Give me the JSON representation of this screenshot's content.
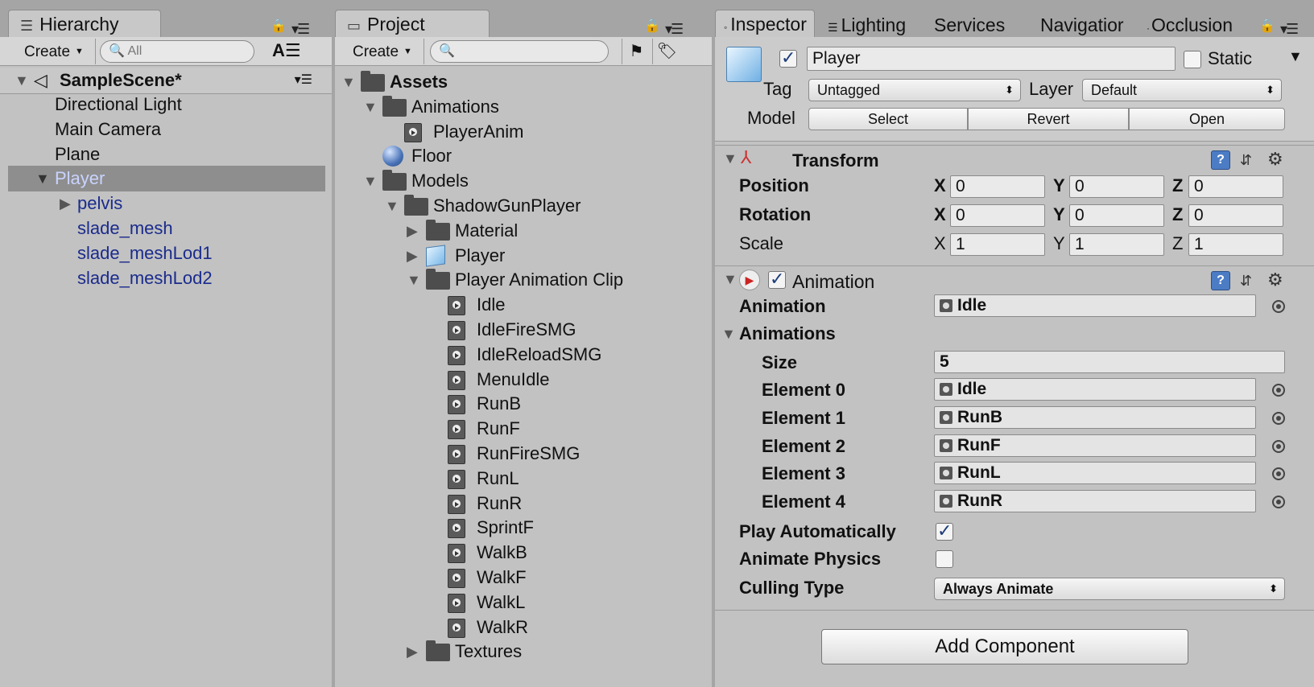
{
  "hierarchy": {
    "tab_label": "Hierarchy",
    "create_label": "Create",
    "search_placeholder": "All",
    "scene_name": "SampleScene*",
    "items": [
      {
        "label": "Directional Light"
      },
      {
        "label": "Main Camera"
      },
      {
        "label": "Plane"
      },
      {
        "label": "Player"
      },
      {
        "label": "pelvis"
      },
      {
        "label": "slade_mesh"
      },
      {
        "label": "slade_meshLod1"
      },
      {
        "label": "slade_meshLod2"
      }
    ]
  },
  "project": {
    "tab_label": "Project",
    "create_label": "Create",
    "search_placeholder": "",
    "items": [
      {
        "label": "Assets",
        "icon": "folder-icon"
      },
      {
        "label": "Animations",
        "icon": "folder-icon"
      },
      {
        "label": "PlayerAnim",
        "icon": "animation-clip-icon"
      },
      {
        "label": "Floor",
        "icon": "material-sphere-icon"
      },
      {
        "label": "Models",
        "icon": "folder-icon"
      },
      {
        "label": "ShadowGunPlayer",
        "icon": "folder-icon"
      },
      {
        "label": "Material",
        "icon": "folder-icon"
      },
      {
        "label": "Player",
        "icon": "prefab-cube-icon"
      },
      {
        "label": "Player Animation Clip",
        "icon": "folder-icon"
      },
      {
        "label": "Idle",
        "icon": "animation-clip-icon"
      },
      {
        "label": "IdleFireSMG",
        "icon": "animation-clip-icon"
      },
      {
        "label": "IdleReloadSMG",
        "icon": "animation-clip-icon"
      },
      {
        "label": "MenuIdle",
        "icon": "animation-clip-icon"
      },
      {
        "label": "RunB",
        "icon": "animation-clip-icon"
      },
      {
        "label": "RunF",
        "icon": "animation-clip-icon"
      },
      {
        "label": "RunFireSMG",
        "icon": "animation-clip-icon"
      },
      {
        "label": "RunL",
        "icon": "animation-clip-icon"
      },
      {
        "label": "RunR",
        "icon": "animation-clip-icon"
      },
      {
        "label": "SprintF",
        "icon": "animation-clip-icon"
      },
      {
        "label": "WalkB",
        "icon": "animation-clip-icon"
      },
      {
        "label": "WalkF",
        "icon": "animation-clip-icon"
      },
      {
        "label": "WalkL",
        "icon": "animation-clip-icon"
      },
      {
        "label": "WalkR",
        "icon": "animation-clip-icon"
      },
      {
        "label": "Textures",
        "icon": "folder-icon"
      }
    ]
  },
  "inspector": {
    "tabs": [
      {
        "label": "Inspector"
      },
      {
        "label": "Lighting"
      },
      {
        "label": "Services"
      },
      {
        "label": "Navigatior"
      },
      {
        "label": "Occlusion"
      }
    ],
    "object_name": "Player",
    "static_label": "Static",
    "tag_label": "Tag",
    "tag_value": "Untagged",
    "layer_label": "Layer",
    "layer_value": "Default",
    "model_label": "Model",
    "model_buttons": {
      "select": "Select",
      "revert": "Revert",
      "open": "Open"
    },
    "transform": {
      "title": "Transform",
      "position_label": "Position",
      "rotation_label": "Rotation",
      "scale_label": "Scale",
      "axis": {
        "x": "X",
        "y": "Y",
        "z": "Z"
      },
      "position": {
        "x": "0",
        "y": "0",
        "z": "0"
      },
      "rotation": {
        "x": "0",
        "y": "0",
        "z": "0"
      },
      "scale": {
        "x": "1",
        "y": "1",
        "z": "1"
      }
    },
    "animation": {
      "title": "Animation",
      "animation_label": "Animation",
      "animation_value": "Idle",
      "animations_label": "Animations",
      "size_label": "Size",
      "size_value": "5",
      "elements": [
        {
          "label": "Element 0",
          "value": "Idle"
        },
        {
          "label": "Element 1",
          "value": "RunB"
        },
        {
          "label": "Element 2",
          "value": "RunF"
        },
        {
          "label": "Element 3",
          "value": "RunL"
        },
        {
          "label": "Element 4",
          "value": "RunR"
        }
      ],
      "play_auto_label": "Play Automatically",
      "play_auto_checked": true,
      "animate_physics_label": "Animate Physics",
      "animate_physics_checked": false,
      "culling_label": "Culling Type",
      "culling_value": "Always Animate"
    },
    "add_component_label": "Add Component"
  },
  "colors": {
    "selection_bg": "#8e8e8e",
    "child_text_blue": "#1a2b8c",
    "selected_text": "#c9d3ff"
  }
}
